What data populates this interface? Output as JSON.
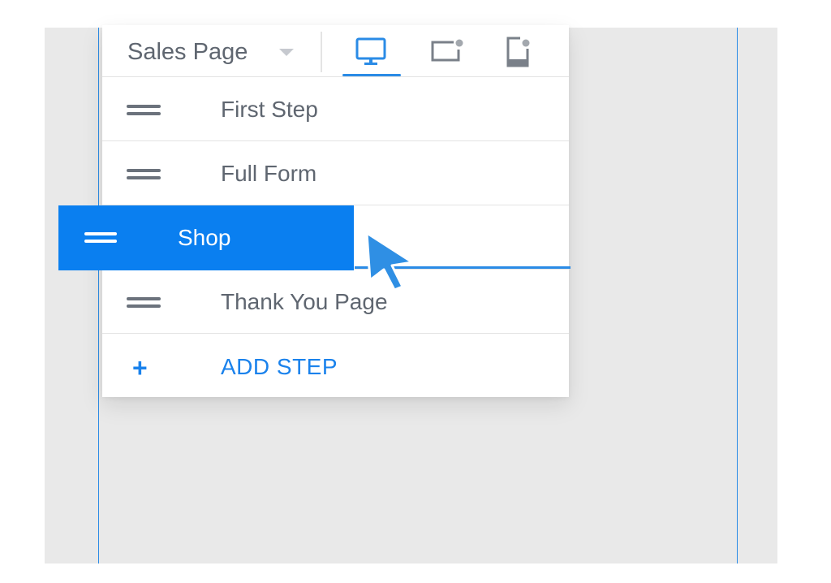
{
  "header": {
    "page_select": {
      "selected": "Sales Page"
    },
    "devices": [
      {
        "name": "desktop",
        "icon": "desktop-icon",
        "active": true
      },
      {
        "name": "tablet",
        "icon": "tablet-icon",
        "active": false
      },
      {
        "name": "mobile",
        "icon": "mobile-icon",
        "active": false
      }
    ]
  },
  "steps": [
    {
      "label": "First Step"
    },
    {
      "label": "Full Form"
    },
    {
      "label": ""
    },
    {
      "label": "Thank You Page"
    }
  ],
  "dragging": {
    "label": "Shop"
  },
  "add_step": {
    "icon": "+",
    "label": "ADD STEP"
  },
  "colors": {
    "accent": "#1a82ec",
    "drag_highlight": "#0a7ff0",
    "canvas": "#e9e9e9",
    "text": "#5f6670"
  }
}
